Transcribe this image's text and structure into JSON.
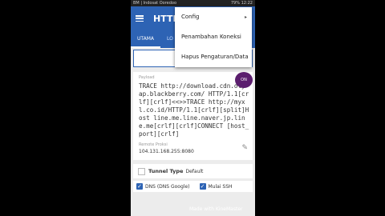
{
  "statusbar": {
    "left": "BM | Indosat Ooredoo",
    "right": "79% 12:22"
  },
  "appbar": {
    "title": "HTTP"
  },
  "tabs": [
    {
      "label": "UTAMA"
    },
    {
      "label": "LO"
    }
  ],
  "payload": {
    "label": "Payload",
    "text": "TRACE http://download.cdn.oly-ap.blackberry.com/ HTTP/1.1[crlf][crlf]<<>>TRACE http://myxl.co.id/HTTP/1.1[crlf][split]Host line.me.line.naver.jp.line.me[crlf][crlf]CONNECT [host_port][crlf]"
  },
  "remote_proxy": {
    "label": "Remote Proksi",
    "value": "104.131.168.255:8080"
  },
  "tunnel": {
    "label": "Tunnel Type",
    "value": "Default"
  },
  "options": {
    "dns": "DNS (DNS Google)",
    "ssh": "Mulai SSH"
  },
  "menu": {
    "items": [
      "Config",
      "Penambahan Koneksi",
      "Hapus Pengaturan/Data"
    ]
  },
  "badge": {
    "text": "ON"
  },
  "watermark": {
    "text": "Made with KineMaster"
  }
}
